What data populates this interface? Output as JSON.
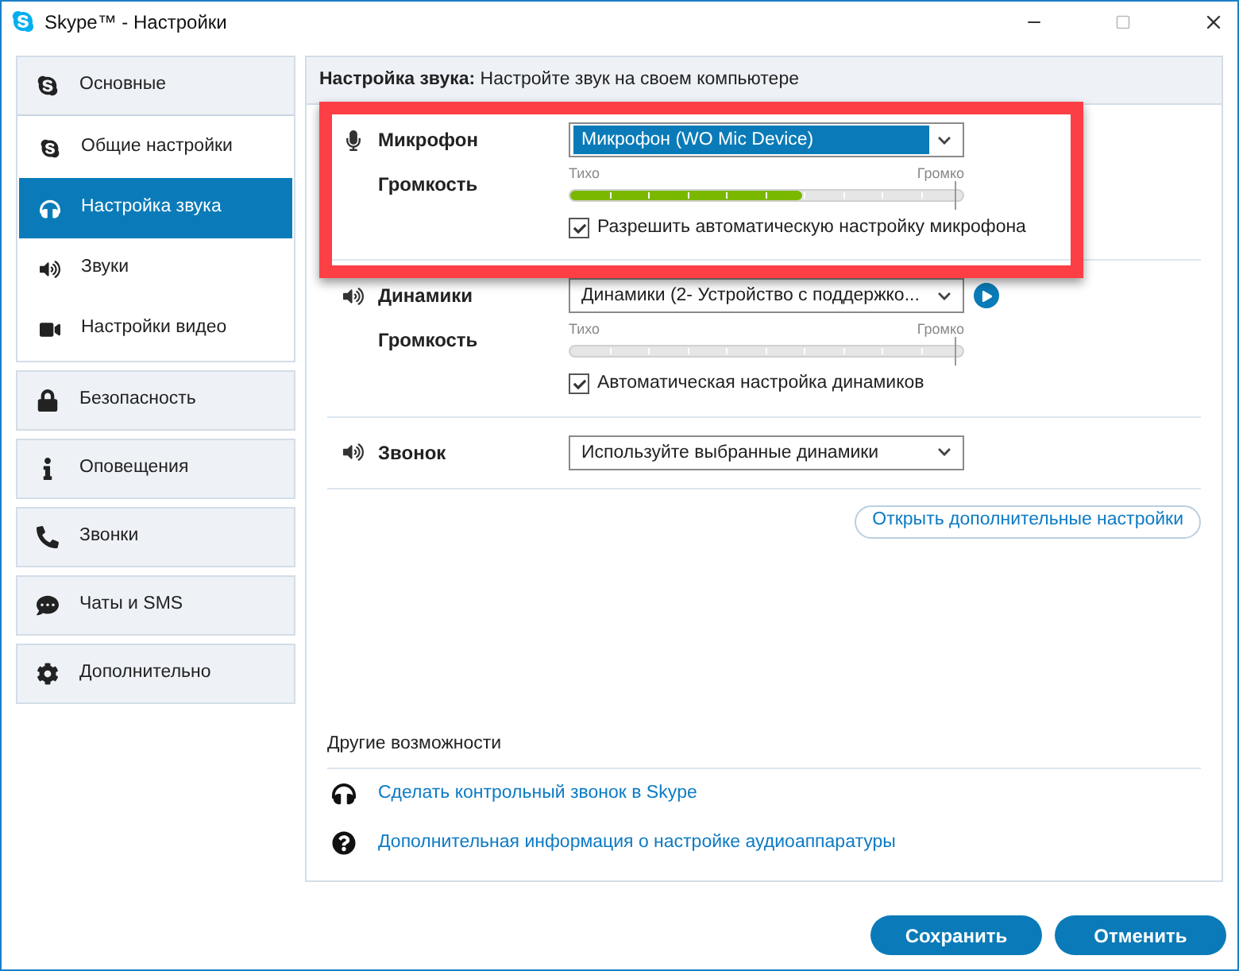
{
  "window": {
    "title": "Skype™ - Настройки"
  },
  "sidebar": {
    "groups": [
      {
        "label": "Основные",
        "selected": false,
        "children": [
          {
            "label": "Общие настройки",
            "selected": false
          },
          {
            "label": "Настройка звука",
            "selected": true
          },
          {
            "label": "Звуки",
            "selected": false
          },
          {
            "label": "Настройки видео",
            "selected": false
          }
        ]
      },
      {
        "label": "Безопасность",
        "selected": false
      },
      {
        "label": "Оповещения",
        "selected": false
      },
      {
        "label": "Звонки",
        "selected": false
      },
      {
        "label": "Чаты и SMS",
        "selected": false
      },
      {
        "label": "Дополнительно",
        "selected": false
      }
    ]
  },
  "main": {
    "header": "**Настройка звука:** Настройте звук на своем компьютере",
    "devices": [
      {
        "label": "Микрофон",
        "value": "Микрофон (WO Mic Device)",
        "focused": true,
        "highlighted": true,
        "play_button": false,
        "volume": {
          "label": "Громкость",
          "quiet": "Тихо",
          "loud": "Громко",
          "level": 0.59
        },
        "checkbox": {
          "label": "Разрешить автоматическую настройку микрофона",
          "checked": true
        }
      },
      {
        "label": "Динамики",
        "value": "Динамики (2- Устройство с поддержко...",
        "focused": false,
        "highlighted": false,
        "play_button": true,
        "volume": {
          "label": "Громкость",
          "quiet": "Тихо",
          "loud": "Громко"
        },
        "checkbox": {
          "label": "Автоматическая настройка динамиков",
          "checked": true
        }
      },
      {
        "label": "Звонок",
        "value": "Используйте выбранные динамики",
        "focused": false,
        "highlighted": false,
        "play_button": false
      }
    ],
    "advanced_button": "Открыть дополнительные настройки",
    "other": {
      "title": "Другие возможности",
      "links": [
        "Сделать контрольный звонок в Skype",
        "Дополнительная информация о настройке аудиоаппаратуры"
      ]
    }
  },
  "buttons": [
    "Сохранить",
    "Отменить"
  ]
}
